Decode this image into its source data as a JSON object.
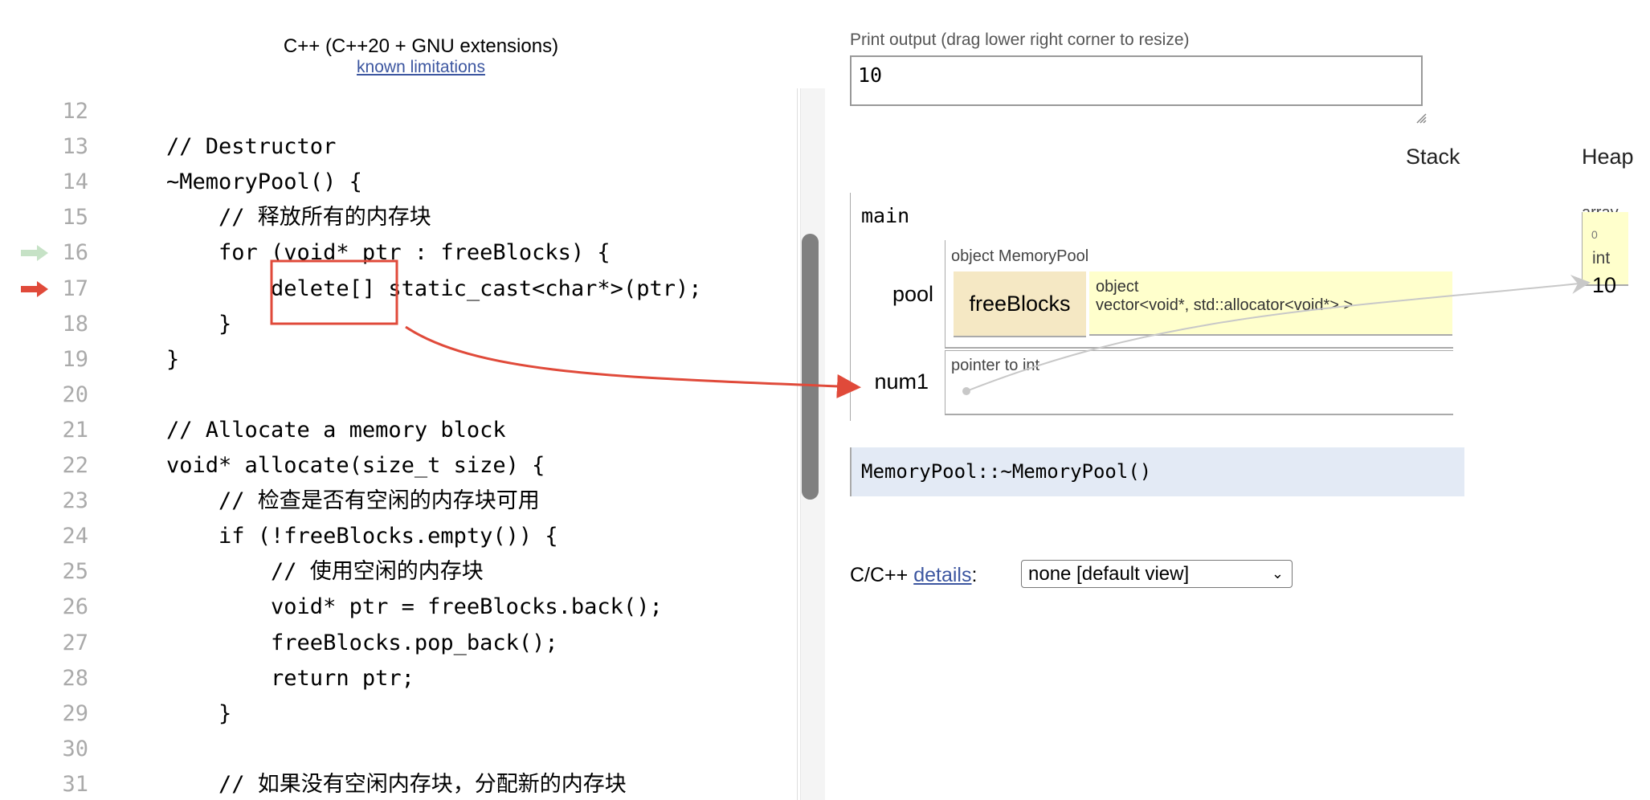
{
  "header": {
    "language": "C++ (C++20 + GNU extensions)",
    "limitations_link": "known limitations"
  },
  "code": {
    "lines": [
      {
        "num": "12",
        "text": ""
      },
      {
        "num": "13",
        "text": "// Destructor"
      },
      {
        "num": "14",
        "text": "~MemoryPool() {"
      },
      {
        "num": "15",
        "text": "    // 释放所有的内存块"
      },
      {
        "num": "16",
        "text": "    for (void* ptr : freeBlocks) {",
        "marker": "prev"
      },
      {
        "num": "17",
        "text": "        delete[] static_cast<char*>(ptr);",
        "marker": "next"
      },
      {
        "num": "18",
        "text": "    }"
      },
      {
        "num": "19",
        "text": "}"
      },
      {
        "num": "20",
        "text": ""
      },
      {
        "num": "21",
        "text": "// Allocate a memory block"
      },
      {
        "num": "22",
        "text": "void* allocate(size_t size) {"
      },
      {
        "num": "23",
        "text": "    // 检查是否有空闲的内存块可用"
      },
      {
        "num": "24",
        "text": "    if (!freeBlocks.empty()) {"
      },
      {
        "num": "25",
        "text": "        // 使用空闲的内存块"
      },
      {
        "num": "26",
        "text": "        void* ptr = freeBlocks.back();"
      },
      {
        "num": "27",
        "text": "        freeBlocks.pop_back();"
      },
      {
        "num": "28",
        "text": "        return ptr;"
      },
      {
        "num": "29",
        "text": "    }"
      },
      {
        "num": "30",
        "text": ""
      },
      {
        "num": "31",
        "text": "    // 如果没有空闲内存块，分配新的内存块"
      }
    ],
    "prev_arrow_color": "#c6e2c6",
    "next_arrow_color": "#e04a3a"
  },
  "output": {
    "label": "Print output (drag lower right corner to resize)",
    "value": "10"
  },
  "viz": {
    "stack_heading": "Stack",
    "heap_heading": "Heap",
    "frame": {
      "name": "main",
      "vars": [
        {
          "name": "pool",
          "type_label": "object MemoryPool",
          "field": "freeBlocks",
          "field_type_line1": "object",
          "field_type_line2": "vector<void*, std::allocator<void*> >"
        },
        {
          "name": "num1",
          "type_label": "pointer to int"
        }
      ]
    },
    "heap": {
      "label": "array",
      "index": "0",
      "type": "int",
      "value": "10"
    },
    "current_function": "MemoryPool::~MemoryPool()"
  },
  "details": {
    "prefix": "C/C++",
    "link": "details",
    "suffix": ":",
    "selected": "none [default view]"
  },
  "annotation_color": "#e04a3a",
  "pointer_color": "#c8c8c8"
}
